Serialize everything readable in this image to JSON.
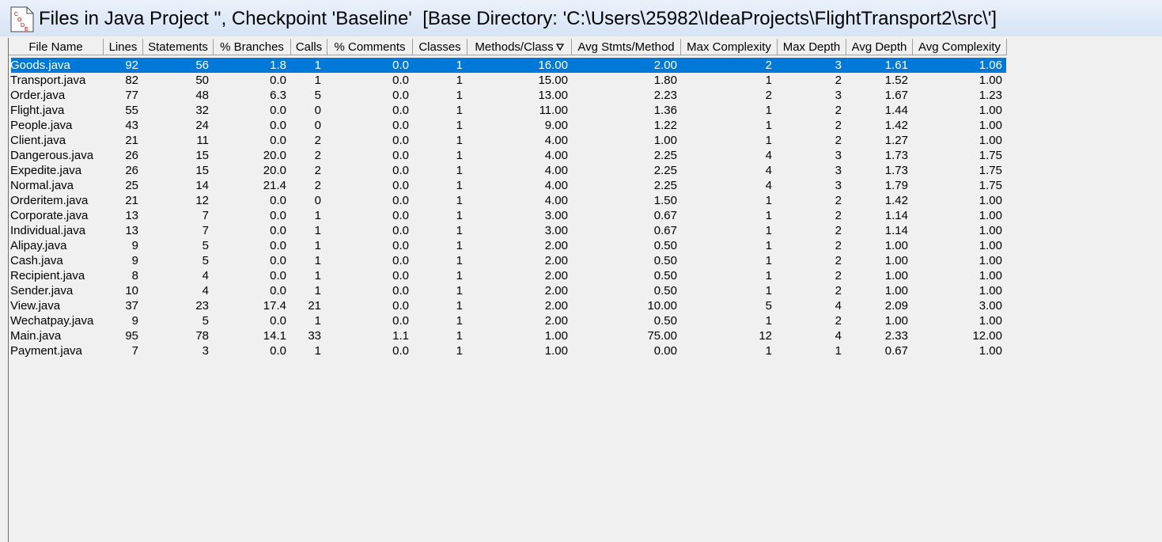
{
  "window": {
    "title": "Files in Java Project '', Checkpoint 'Baseline'  [Base Directory: 'C:\\Users\\25982\\IdeaProjects\\FlightTransport2\\src\\']",
    "icon": "code-file-icon"
  },
  "table": {
    "sorted_column": "Methods/Class",
    "sort_icon": "sort-descending-icon",
    "selected_row": 0,
    "columns": [
      "File Name",
      "Lines",
      "Statements",
      "% Branches",
      "Calls",
      "% Comments",
      "Classes",
      "Methods/Class",
      "Avg Stmts/Method",
      "Max Complexity",
      "Max Depth",
      "Avg Depth",
      "Avg Complexity"
    ],
    "rows": [
      [
        "Goods.java",
        "92",
        "56",
        "1.8",
        "1",
        "0.0",
        "1",
        "16.00",
        "2.00",
        "2",
        "3",
        "1.61",
        "1.06"
      ],
      [
        "Transport.java",
        "82",
        "50",
        "0.0",
        "1",
        "0.0",
        "1",
        "15.00",
        "1.80",
        "1",
        "2",
        "1.52",
        "1.00"
      ],
      [
        "Order.java",
        "77",
        "48",
        "6.3",
        "5",
        "0.0",
        "1",
        "13.00",
        "2.23",
        "2",
        "3",
        "1.67",
        "1.23"
      ],
      [
        "Flight.java",
        "55",
        "32",
        "0.0",
        "0",
        "0.0",
        "1",
        "11.00",
        "1.36",
        "1",
        "2",
        "1.44",
        "1.00"
      ],
      [
        "People.java",
        "43",
        "24",
        "0.0",
        "0",
        "0.0",
        "1",
        "9.00",
        "1.22",
        "1",
        "2",
        "1.42",
        "1.00"
      ],
      [
        "Client.java",
        "21",
        "11",
        "0.0",
        "2",
        "0.0",
        "1",
        "4.00",
        "1.00",
        "1",
        "2",
        "1.27",
        "1.00"
      ],
      [
        "Dangerous.java",
        "26",
        "15",
        "20.0",
        "2",
        "0.0",
        "1",
        "4.00",
        "2.25",
        "4",
        "3",
        "1.73",
        "1.75"
      ],
      [
        "Expedite.java",
        "26",
        "15",
        "20.0",
        "2",
        "0.0",
        "1",
        "4.00",
        "2.25",
        "4",
        "3",
        "1.73",
        "1.75"
      ],
      [
        "Normal.java",
        "25",
        "14",
        "21.4",
        "2",
        "0.0",
        "1",
        "4.00",
        "2.25",
        "4",
        "3",
        "1.79",
        "1.75"
      ],
      [
        "Orderitem.java",
        "21",
        "12",
        "0.0",
        "0",
        "0.0",
        "1",
        "4.00",
        "1.50",
        "1",
        "2",
        "1.42",
        "1.00"
      ],
      [
        "Corporate.java",
        "13",
        "7",
        "0.0",
        "1",
        "0.0",
        "1",
        "3.00",
        "0.67",
        "1",
        "2",
        "1.14",
        "1.00"
      ],
      [
        "Individual.java",
        "13",
        "7",
        "0.0",
        "1",
        "0.0",
        "1",
        "3.00",
        "0.67",
        "1",
        "2",
        "1.14",
        "1.00"
      ],
      [
        "Alipay.java",
        "9",
        "5",
        "0.0",
        "1",
        "0.0",
        "1",
        "2.00",
        "0.50",
        "1",
        "2",
        "1.00",
        "1.00"
      ],
      [
        "Cash.java",
        "9",
        "5",
        "0.0",
        "1",
        "0.0",
        "1",
        "2.00",
        "0.50",
        "1",
        "2",
        "1.00",
        "1.00"
      ],
      [
        "Recipient.java",
        "8",
        "4",
        "0.0",
        "1",
        "0.0",
        "1",
        "2.00",
        "0.50",
        "1",
        "2",
        "1.00",
        "1.00"
      ],
      [
        "Sender.java",
        "10",
        "4",
        "0.0",
        "1",
        "0.0",
        "1",
        "2.00",
        "0.50",
        "1",
        "2",
        "1.00",
        "1.00"
      ],
      [
        "View.java",
        "37",
        "23",
        "17.4",
        "21",
        "0.0",
        "1",
        "2.00",
        "10.00",
        "5",
        "4",
        "2.09",
        "3.00"
      ],
      [
        "Wechatpay.java",
        "9",
        "5",
        "0.0",
        "1",
        "0.0",
        "1",
        "2.00",
        "0.50",
        "1",
        "2",
        "1.00",
        "1.00"
      ],
      [
        "Main.java",
        "95",
        "78",
        "14.1",
        "33",
        "1.1",
        "1",
        "1.00",
        "75.00",
        "12",
        "4",
        "2.33",
        "12.00"
      ],
      [
        "Payment.java",
        "7",
        "3",
        "0.0",
        "1",
        "0.0",
        "1",
        "1.00",
        "0.00",
        "1",
        "1",
        "0.67",
        "1.00"
      ]
    ]
  },
  "colors": {
    "selection": "#0078d7",
    "background": "#f0f0f0"
  }
}
